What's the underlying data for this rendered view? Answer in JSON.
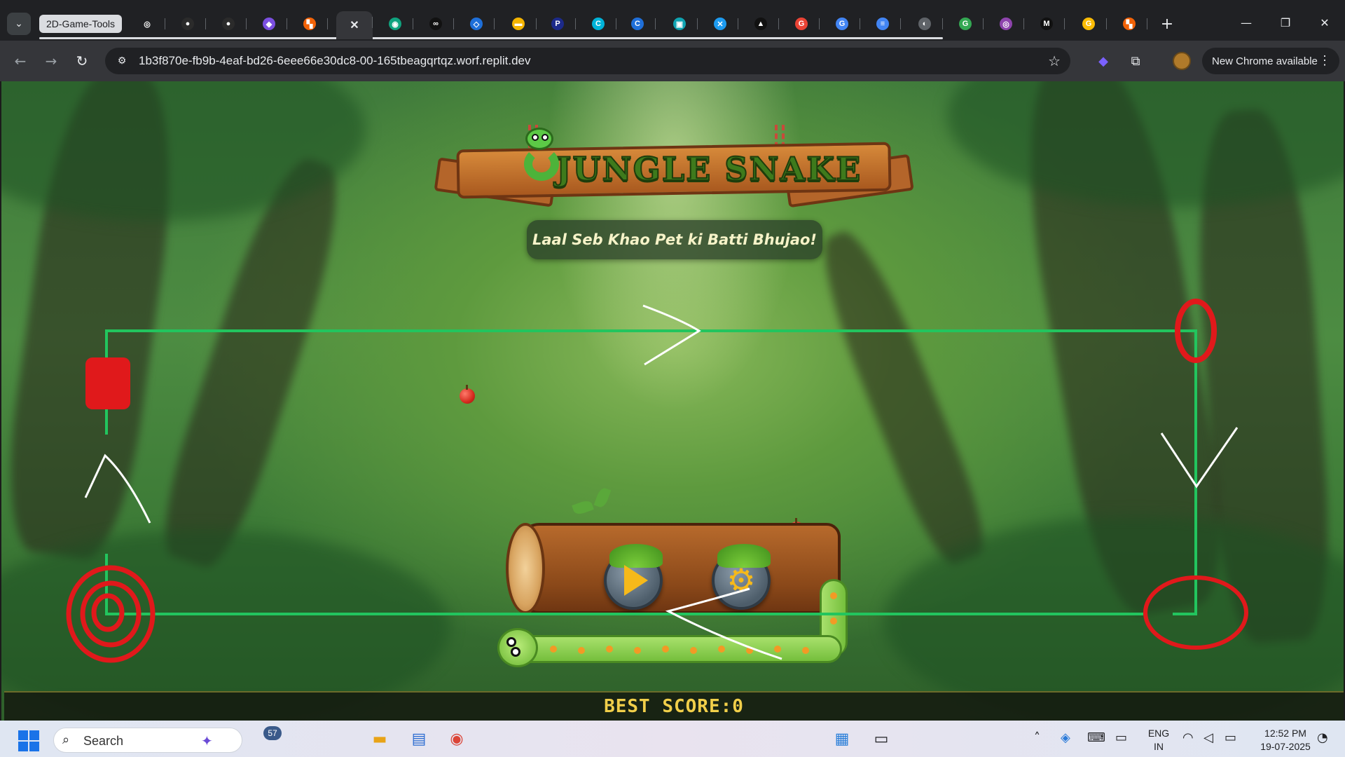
{
  "browser": {
    "tab_group_label": "2D-Game-Tools",
    "active_tab_close": "✕",
    "tabs": [
      {
        "icon": "openai-icon",
        "glyph": "◎",
        "color": "#202124"
      },
      {
        "icon": "github-icon",
        "glyph": "●",
        "color": "#2b2b2b"
      },
      {
        "icon": "github-icon-2",
        "glyph": "●",
        "color": "#2b2b2b"
      },
      {
        "icon": "copilot-icon",
        "glyph": "◆",
        "color": "#7b4fe0"
      },
      {
        "icon": "replit-icon",
        "glyph": "▚",
        "color": "#f26207"
      },
      {
        "icon": "active-tab",
        "glyph": "✕",
        "color": "transparent"
      },
      {
        "icon": "chatbot-icon",
        "glyph": "◉",
        "color": "#10a37f"
      },
      {
        "icon": "infinity-icon",
        "glyph": "∞",
        "color": "#111111"
      },
      {
        "icon": "code-icon",
        "glyph": "◇",
        "color": "#1e6fd9"
      },
      {
        "icon": "slides-icon",
        "glyph": "▬",
        "color": "#f4b400"
      },
      {
        "icon": "p-icon",
        "glyph": "P",
        "color": "#1c2a8a"
      },
      {
        "icon": "canva-icon",
        "glyph": "C",
        "color": "#00b3d9"
      },
      {
        "icon": "canva-icon-2",
        "glyph": "C",
        "color": "#1f6fd9"
      },
      {
        "icon": "doc-icon",
        "glyph": "▣",
        "color": "#0fa3b1"
      },
      {
        "icon": "x-icon",
        "glyph": "✕",
        "color": "#1d9bf0"
      },
      {
        "icon": "triangle-icon",
        "glyph": "▲",
        "color": "#111111"
      },
      {
        "icon": "google-icon",
        "glyph": "G",
        "color": "#ea4335"
      },
      {
        "icon": "google-icon-2",
        "glyph": "G",
        "color": "#4285f4"
      },
      {
        "icon": "forms-icon",
        "glyph": "≡",
        "color": "#4285f4"
      },
      {
        "icon": "globe-icon",
        "glyph": "◐",
        "color": "#5f6368"
      },
      {
        "icon": "google-icon-3",
        "glyph": "G",
        "color": "#34a853"
      },
      {
        "icon": "eye-icon",
        "glyph": "◎",
        "color": "#8e44ad"
      },
      {
        "icon": "m-icon",
        "glyph": "M",
        "color": "#111111"
      },
      {
        "icon": "google-icon-4",
        "glyph": "G",
        "color": "#fbbc05"
      },
      {
        "icon": "replit-icon-2",
        "glyph": "▚",
        "color": "#f26207"
      }
    ],
    "url": "1b3f870e-fb9b-4eaf-bd26-6eee66e30dc8-00-165tbeagqrtqz.worf.replit.dev",
    "new_chrome_label": "New Chrome available"
  },
  "game": {
    "title": "JUNGLE SNAKE",
    "tagline": "Laal Seb Khao Pet ki Batti Bhujao!",
    "best_score_label": "BEST SCORE:0",
    "colors": {
      "title_green": "#3e7a1c",
      "score_gold": "#f1cf4a",
      "path_green": "#22c55e",
      "annotation_red": "#e0191b"
    }
  },
  "taskbar": {
    "search_label": "Search",
    "notification_count": "57",
    "lang_top": "ENG",
    "lang_bottom": "IN",
    "time": "12:52 PM",
    "date": "19-07-2025"
  }
}
